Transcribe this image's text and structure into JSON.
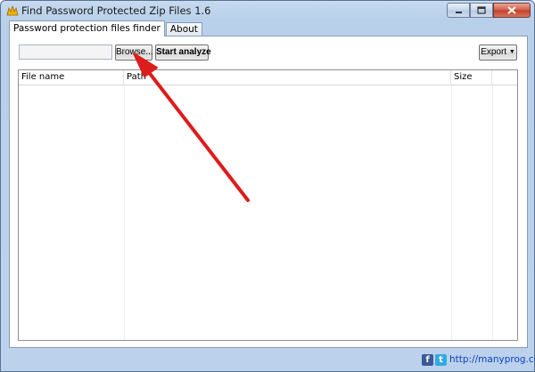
{
  "window": {
    "title": "Find Password Protected Zip Files 1.6",
    "minimize_icon": "minimize-icon",
    "maximize_icon": "maximize-icon",
    "close_icon": "close-icon"
  },
  "tabs": [
    {
      "label": "Password protection files finder",
      "active": true
    },
    {
      "label": "About",
      "active": false
    }
  ],
  "toolbar": {
    "path_value": "",
    "path_placeholder": "",
    "browse_label": "Browse...",
    "analyze_label": "Start analyze",
    "export_label": "Export"
  },
  "table": {
    "columns": [
      "File name",
      "Path",
      "Size",
      ""
    ],
    "rows": []
  },
  "status": {
    "facebook_icon": "facebook-icon",
    "twitter_icon": "twitter-icon",
    "link": "http://manyprog.com"
  },
  "annotation": {
    "color": "#dd1c1c",
    "icon": "arrow-icon"
  }
}
